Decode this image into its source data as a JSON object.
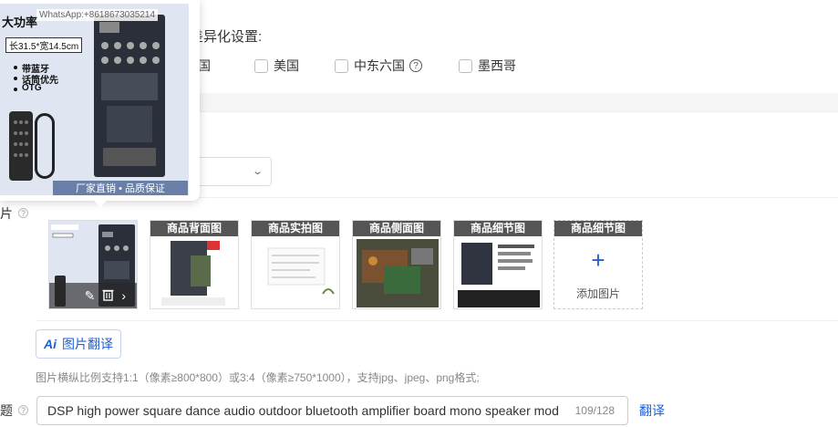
{
  "region": {
    "title": "差异化设置:",
    "options": [
      {
        "label": "韩国"
      },
      {
        "label": "美国"
      },
      {
        "label": "中东六国"
      },
      {
        "label": "墨西哥"
      }
    ]
  },
  "images": {
    "label": "片",
    "thumbs": [
      {
        "label": "商品背面图"
      },
      {
        "label": "商品实拍图"
      },
      {
        "label": "商品侧面图"
      },
      {
        "label": "商品细节图"
      }
    ],
    "add": {
      "label": "商品细节图",
      "plus": "+",
      "text": "添加图片"
    },
    "ai_button": {
      "ai": "Ai",
      "label": "图片翻译"
    },
    "hint": "图片横纵比例支持1:1（像素≥800*800）或3:4（像素≥750*1000），支持jpg、jpeg、png格式;"
  },
  "title_field": {
    "label": "题",
    "value": "DSP high power square dance audio outdoor bluetooth amplifier board mono speaker mod",
    "count": "109/128",
    "translate": "翻译"
  },
  "preview": {
    "watermark": "WhatsApp:+8618673035214",
    "headline": "大功率",
    "dimensions": "长31.5*宽14.5cm",
    "features": [
      "带蓝牙",
      "话筒优先",
      "OTG"
    ],
    "footer": "厂家直销 • 品质保证"
  },
  "colors": {
    "accent": "#1f5fd8",
    "label_bg": "#555555"
  }
}
